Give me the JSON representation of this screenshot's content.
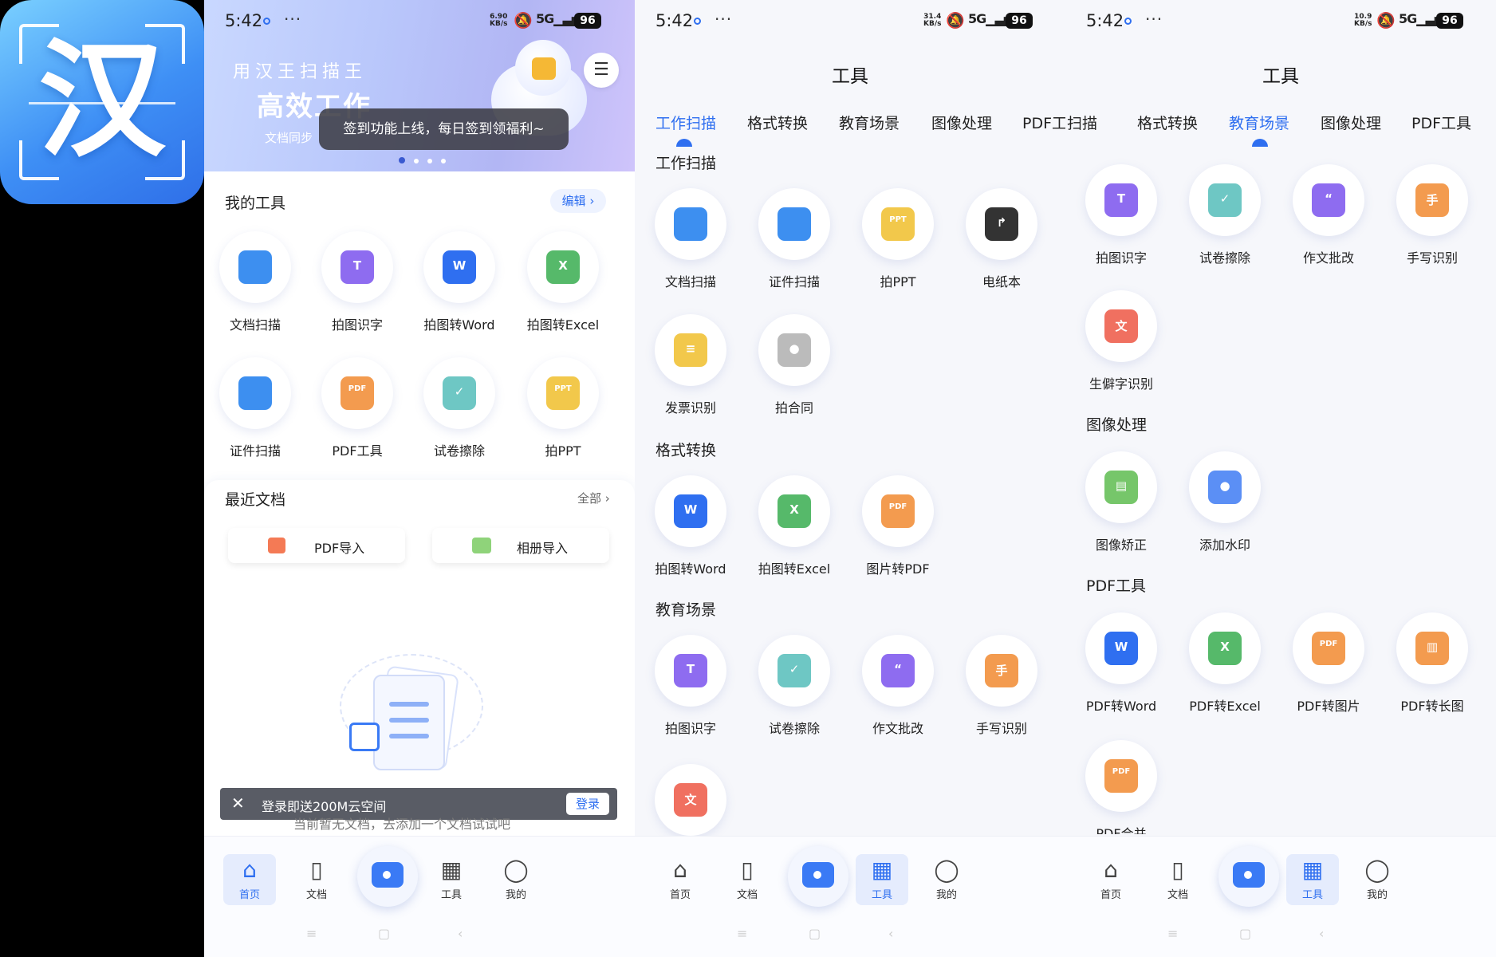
{
  "logo": {
    "char": "汉"
  },
  "status": [
    {
      "time": "5:42",
      "net_top": "6.90",
      "net_bottom": "KB/s",
      "signal": "5G",
      "battery": "96"
    },
    {
      "time": "5:42",
      "net_top": "31.4",
      "net_bottom": "KB/s",
      "signal": "5G",
      "battery": "96"
    },
    {
      "time": "5:42",
      "net_top": "10.9",
      "net_bottom": "KB/s",
      "signal": "5G",
      "battery": "96"
    }
  ],
  "home": {
    "banner_slogan": "用汉王扫描王",
    "banner_big": "高效工作",
    "banner_small": "文档同步",
    "toast": "签到功能上线，每日签到领福利~",
    "my_tools": "我的工具",
    "edit": "编辑 ›",
    "tools": [
      "文档扫描",
      "拍图识字",
      "拍图转Word",
      "拍图转Excel",
      "证件扫描",
      "PDF工具",
      "试卷擦除",
      "拍PPT"
    ],
    "recent": "最近文档",
    "all": "全部 ›",
    "pdf_import": "PDF导入",
    "album_import": "相册导入",
    "login_text": "登录即送200M云空间",
    "login_btn": "登录",
    "empty_text": "当前暂无文档，去添加一个文档试试吧"
  },
  "tabs": {
    "home": "首页",
    "docs": "文档",
    "tools": "工具",
    "mine": "我的"
  },
  "tools_page": {
    "title": "工具",
    "cats": [
      "工作扫描",
      "格式转换",
      "教育场景",
      "图像处理",
      "PDF工具"
    ],
    "cats_clipped_p2": "PDF工",
    "cats_clipped_p3": "扫描",
    "sec_work": "工作扫描",
    "work": [
      "文档扫描",
      "证件扫描",
      "拍PPT",
      "电纸本",
      "发票识别",
      "拍合同"
    ],
    "sec_format": "格式转换",
    "format": [
      "拍图转Word",
      "拍图转Excel",
      "图片转PDF"
    ],
    "sec_edu": "教育场景",
    "edu": [
      "拍图识字",
      "试卷擦除",
      "作文批改",
      "手写识别"
    ],
    "edu_extra": "生僻字识别",
    "sec_image": "图像处理",
    "image": [
      "图像矫正",
      "添加水印"
    ],
    "sec_pdf": "PDF工具",
    "pdf": [
      "PDF转Word",
      "PDF转Excel",
      "PDF转图片",
      "PDF转长图"
    ],
    "pdf_extra": "PDF合并"
  },
  "colors": {
    "accent": "#2f6ff0",
    "bg": "#f6f7fb"
  }
}
